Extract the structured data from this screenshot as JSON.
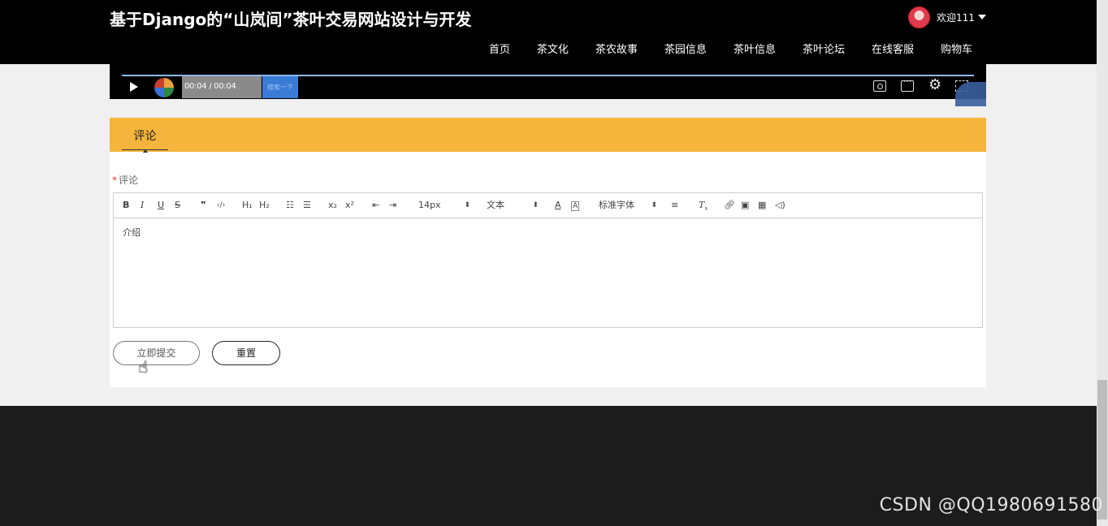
{
  "header": {
    "site_title": "基于Django的“山岚间”茶叶交易网站设计与开发",
    "user_name": "欢迎111",
    "nav": [
      "首页",
      "茶文化",
      "茶农故事",
      "茶园信息",
      "茶叶信息",
      "茶叶论坛",
      "在线客服",
      "购物车"
    ]
  },
  "video": {
    "time": "00:04 / 00:04",
    "search_label": "搜索一下"
  },
  "comment": {
    "tab_label": "评论",
    "required_mark": "*",
    "field_label": "评论",
    "toolbar": {
      "font_size": "14px",
      "text_style": "文本",
      "font_family": "标准字体"
    },
    "editor_content": "介绍",
    "submit_label": "立即提交",
    "reset_label": "重置"
  },
  "watermark": "CSDN @QQ1980691580"
}
